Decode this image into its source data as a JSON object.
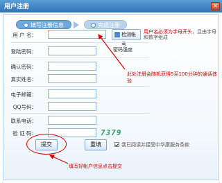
{
  "window": {
    "title": "用户注册",
    "close_label": "×"
  },
  "steps": [
    {
      "label": "填写注册信息",
      "active": true
    },
    {
      "label": "完成注册",
      "active": false
    }
  ],
  "form": {
    "username_label": "用 户 名：",
    "password_label": "登陆密码：",
    "confirm_label": "确认密码：",
    "realname_label": "真实姓名：",
    "email_label": "电子邮箱：",
    "qq_label": "QQ号码：",
    "phone_label": "联系电话：",
    "captcha_label": "验 证 码：",
    "captcha_text": "7379"
  },
  "check_button_label": "检测帐号",
  "password_strength_label": "密码强度",
  "submit_label": "提交",
  "reset_label": "重填",
  "agree_text": "我已阅读并接受中华康服务条款",
  "annotations": {
    "username_note": "用户名必须为字母开头",
    "username_note_tail": "，且由字母和数字组成",
    "account_note": "此处注册会随机获得5至100分钟的通话体验",
    "submit_note": "填写好帐户信息点击提交"
  },
  "colors": {
    "annotation": "#c00000",
    "accent": "#4b8bc9",
    "captcha": "#2c9a63"
  }
}
